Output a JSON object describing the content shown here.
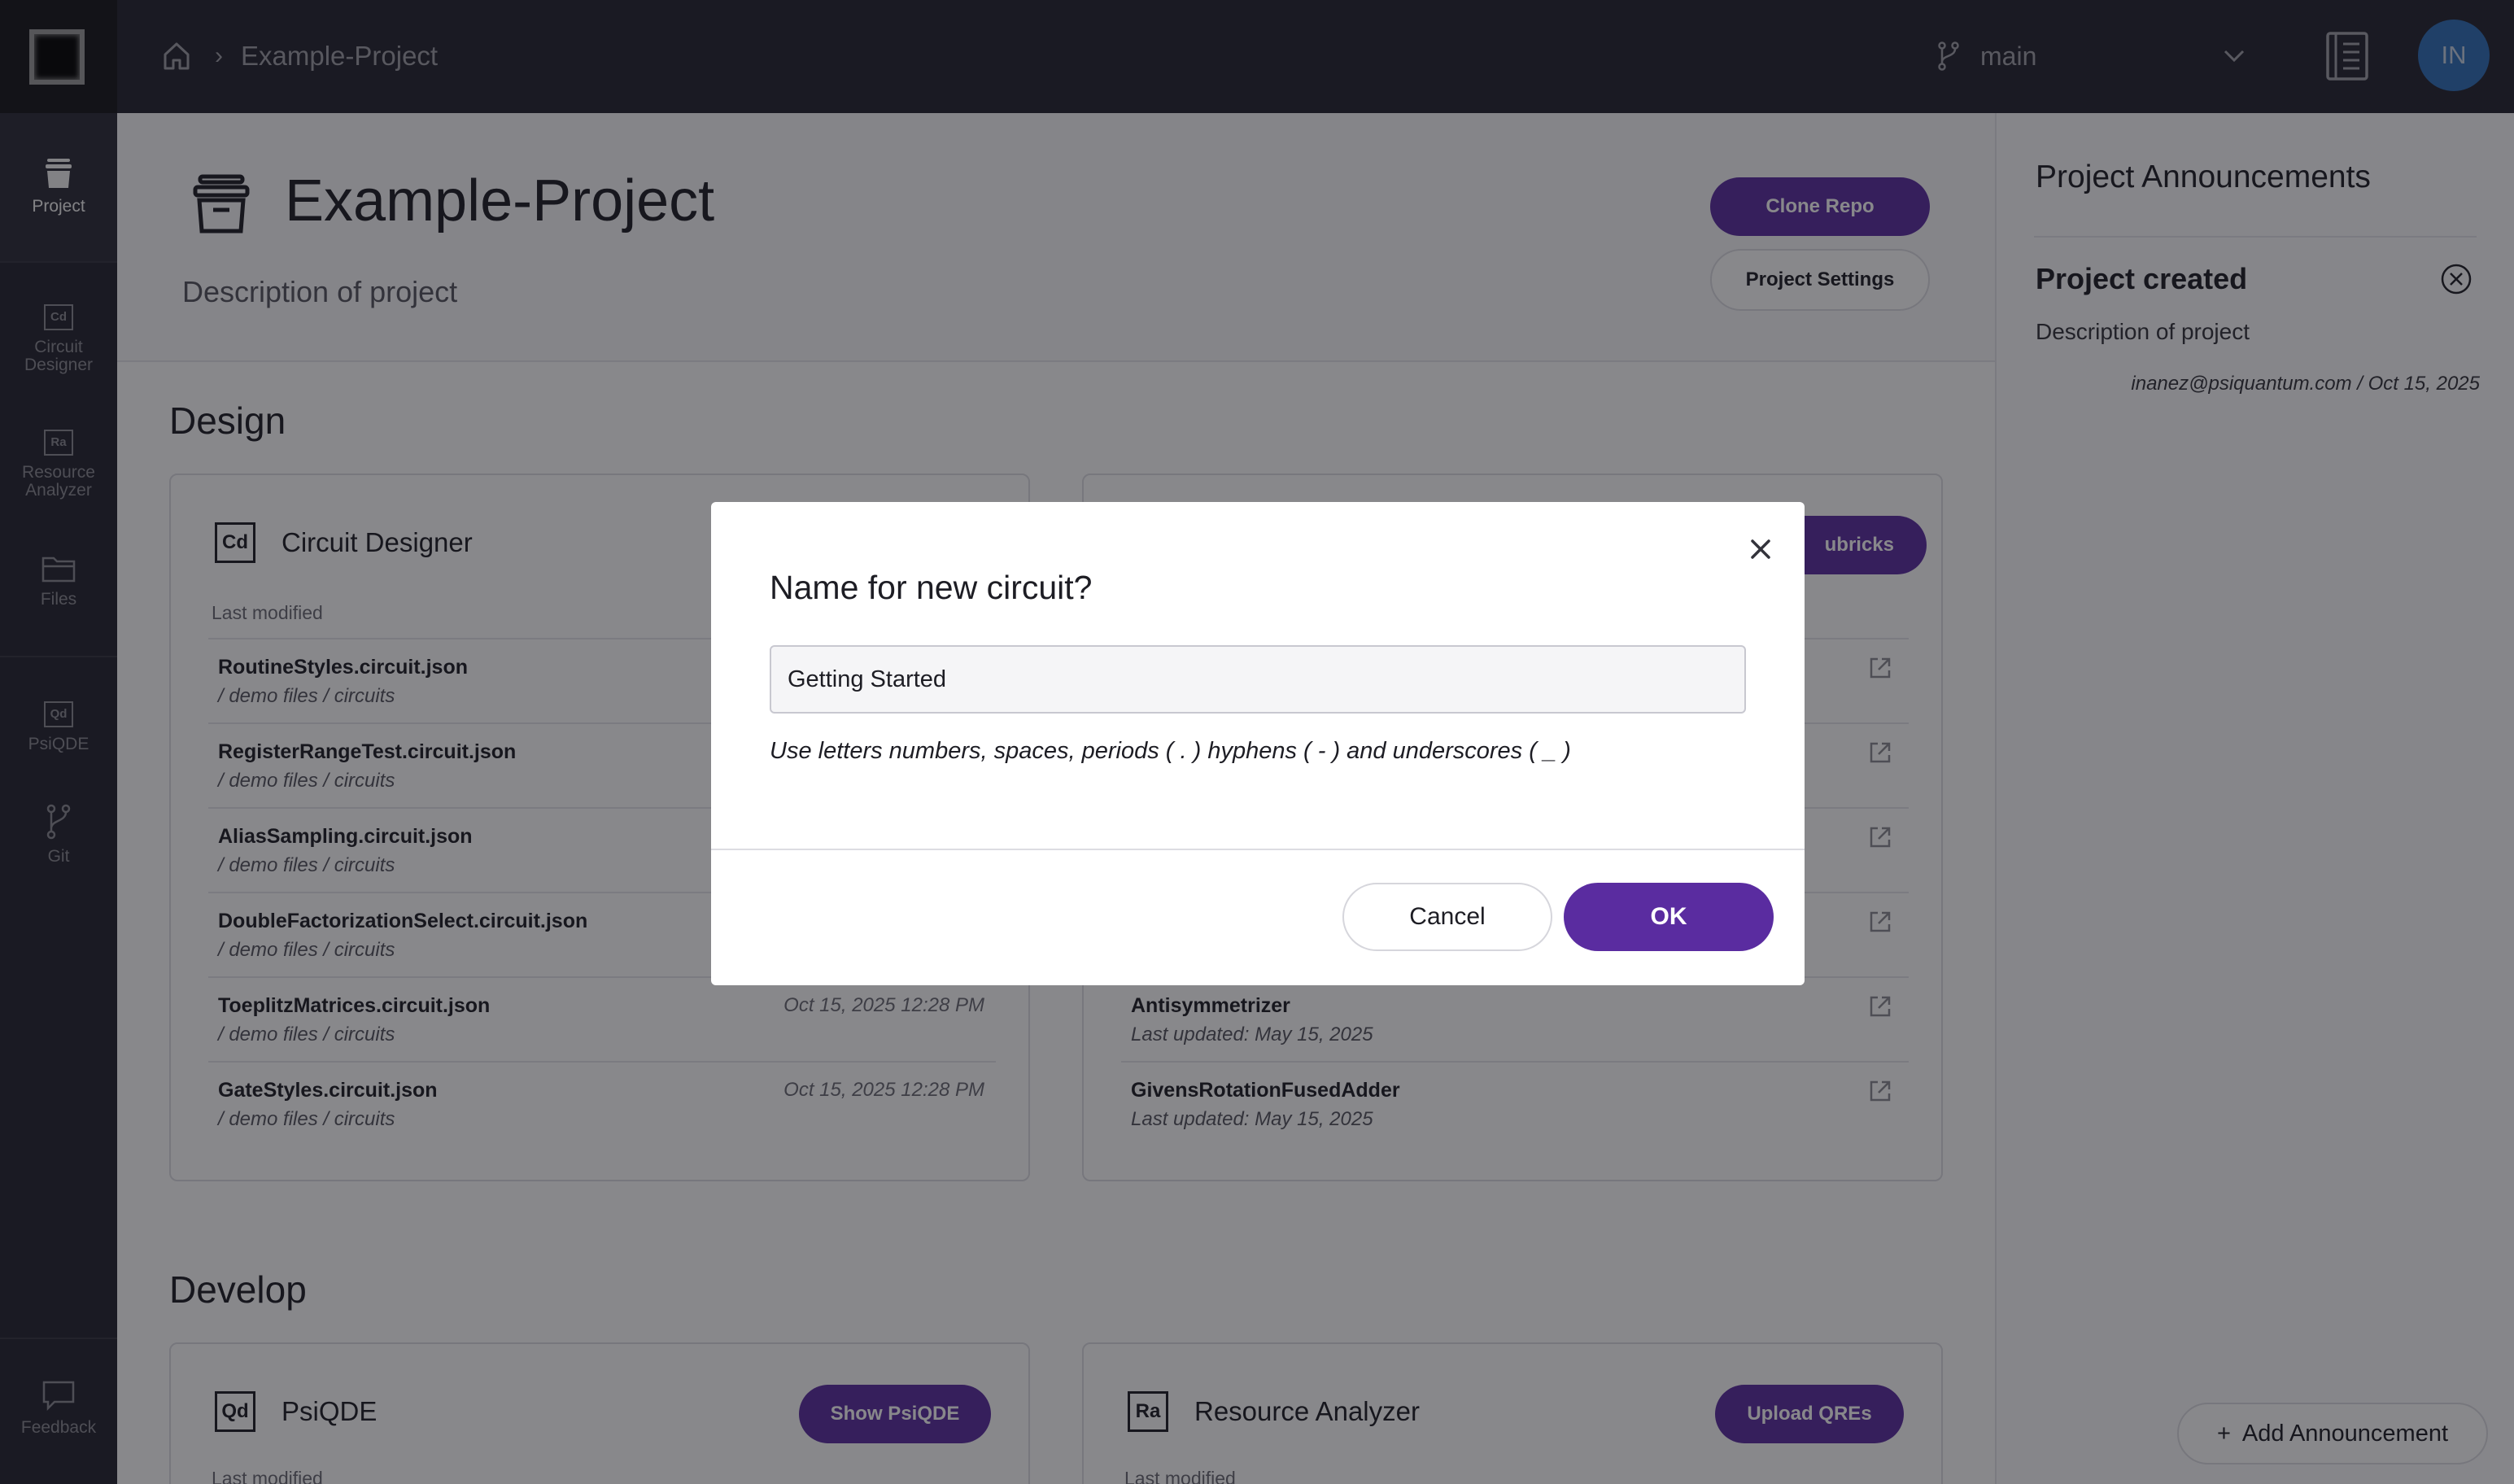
{
  "colors": {
    "accent": "#5a2ca0",
    "sidebar": "#23232f",
    "avatar": "#2f6fb8"
  },
  "topbar": {
    "breadcrumb_project": "Example-Project",
    "branch": "main",
    "avatar_initials": "IN"
  },
  "sidebar": {
    "items": [
      {
        "label": "Project",
        "icon": "archive-icon"
      },
      {
        "label": "Circuit Designer",
        "icon": "cd-box-icon",
        "abbr": "Cd"
      },
      {
        "label": "Resource Analyzer",
        "icon": "ra-box-icon",
        "abbr": "Ra"
      },
      {
        "label": "Files",
        "icon": "folder-icon"
      },
      {
        "label": "PsiQDE",
        "icon": "qd-box-icon",
        "abbr": "Qd"
      },
      {
        "label": "Git",
        "icon": "git-branch-icon"
      }
    ],
    "feedback_label": "Feedback"
  },
  "project": {
    "title": "Example-Project",
    "description": "Description of project",
    "clone_label": "Clone Repo",
    "settings_label": "Project Settings"
  },
  "design": {
    "title": "Design",
    "circuit_card": {
      "icon_abbr": "Cd",
      "title": "Circuit Designer",
      "last_modified_label": "Last modified",
      "rows": [
        {
          "name": "RoutineStyles.circuit.json",
          "path": "/ demo files / circuits",
          "date": ""
        },
        {
          "name": "RegisterRangeTest.circuit.json",
          "path": "/ demo files / circuits",
          "date": ""
        },
        {
          "name": "AliasSampling.circuit.json",
          "path": "/ demo files / circuits",
          "date": ""
        },
        {
          "name": "DoubleFactorizationSelect.circuit.json",
          "path": "/ demo files / circuits",
          "date": ""
        },
        {
          "name": "ToeplitzMatrices.circuit.json",
          "path": "/ demo files / circuits",
          "date": "Oct 15, 2025 12:28 PM"
        },
        {
          "name": "GateStyles.circuit.json",
          "path": "/ demo files / circuits",
          "date": "Oct 15, 2025 12:28 PM"
        }
      ]
    },
    "subricks_card": {
      "button_label": "ubricks",
      "rows": [
        {
          "name": "",
          "updated": ""
        },
        {
          "name": "",
          "updated": ""
        },
        {
          "name": "",
          "updated": ""
        },
        {
          "name": "",
          "updated": ""
        },
        {
          "name": "Antisymmetrizer",
          "updated": "Last updated: May 15, 2025"
        },
        {
          "name": "GivensRotationFusedAdder",
          "updated": "Last updated: May 15, 2025"
        }
      ]
    }
  },
  "develop": {
    "title": "Develop",
    "psiqde_card": {
      "icon_abbr": "Qd",
      "title": "PsiQDE",
      "button_label": "Show PsiQDE",
      "last_modified_label": "Last modified"
    },
    "ra_card": {
      "icon_abbr": "Ra",
      "title": "Resource Analyzer",
      "button_label": "Upload QREs",
      "last_modified_label": "Last modified"
    }
  },
  "announcements": {
    "title": "Project Announcements",
    "item_title": "Project created",
    "item_description": "Description of project",
    "item_meta": "inanez@psiquantum.com / Oct 15, 2025",
    "add_label": "Add Announcement"
  },
  "modal": {
    "title": "Name for new circuit?",
    "input_value": "Getting Started",
    "hint": "Use letters numbers, spaces, periods ( . ) hyphens ( - ) and underscores ( _ )",
    "cancel_label": "Cancel",
    "ok_label": "OK"
  }
}
